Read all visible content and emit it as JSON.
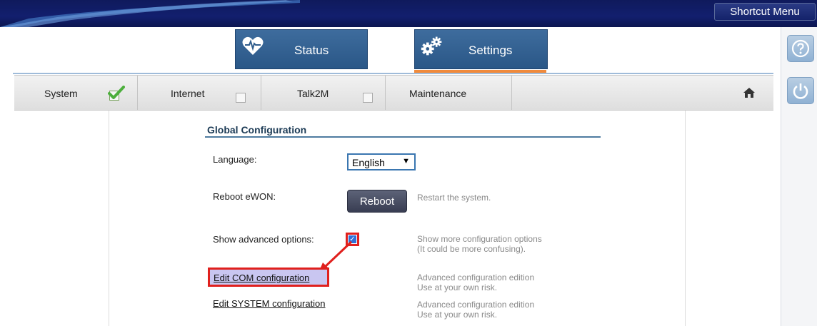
{
  "header": {
    "shortcut_menu": "Shortcut Menu"
  },
  "tabs": [
    {
      "label": "Status",
      "icon": "heart-monitor-icon"
    },
    {
      "label": "Settings",
      "icon": "gears-icon",
      "active": true
    }
  ],
  "subnav": {
    "items": [
      {
        "label": "System",
        "checked": true
      },
      {
        "label": "Internet",
        "checked": false
      },
      {
        "label": "Talk2M",
        "checked": false
      },
      {
        "label": "Maintenance"
      }
    ],
    "home_icon": "home-icon"
  },
  "side_buttons": {
    "help_icon": "help-icon",
    "power_icon": "power-icon"
  },
  "global_config": {
    "title": "Global Configuration",
    "language_label": "Language:",
    "language_value": "English",
    "reboot_label": "Reboot eWON:",
    "reboot_button": "Reboot",
    "reboot_hint": "Restart the system.",
    "advanced_label": "Show advanced options:",
    "advanced_checked": true,
    "advanced_hint_1": "Show more configuration options",
    "advanced_hint_2": "(It could be more confusing).",
    "edit_com_link": "Edit COM configuration",
    "edit_com_hint_1": "Advanced configuration edition",
    "edit_com_hint_2": "Use at your own risk.",
    "edit_system_link": "Edit SYSTEM configuration",
    "edit_system_hint_1": "Advanced configuration edition",
    "edit_system_hint_2": "Use at your own risk."
  },
  "colors": {
    "topbar": "#121f6e",
    "tab": "#2f5c8c",
    "active_indicator": "#f08a3c",
    "highlight": "#e0201d"
  }
}
